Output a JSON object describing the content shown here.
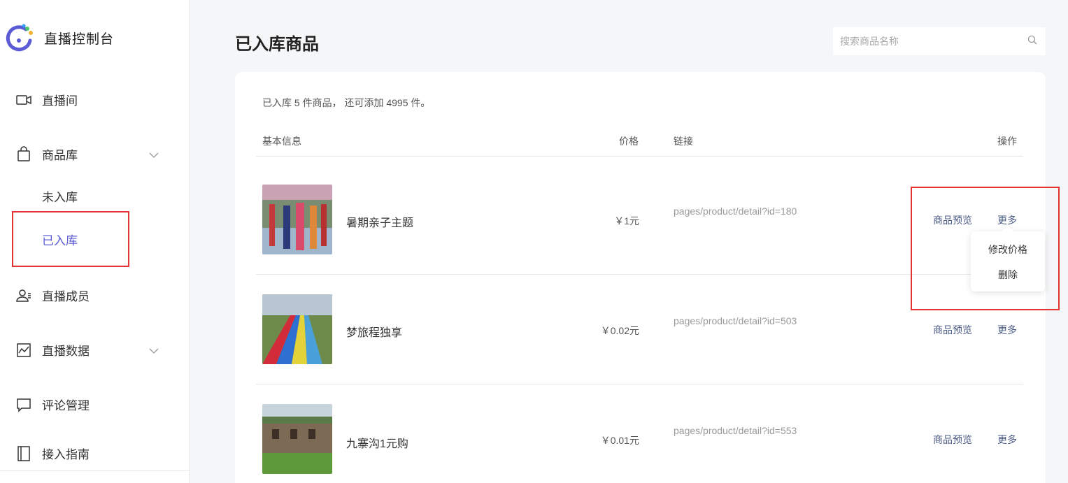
{
  "brand": {
    "name": "直播控制台",
    "icon": "brand-logo-icon"
  },
  "sidebar": {
    "items": [
      {
        "label": "直播间",
        "icon": "video-camera-icon"
      },
      {
        "label": "商品库",
        "icon": "shopping-bag-icon",
        "expanded": true,
        "children": [
          {
            "label": "未入库"
          },
          {
            "label": "已入库",
            "active": true
          }
        ]
      },
      {
        "label": "直播成员",
        "icon": "members-icon"
      },
      {
        "label": "直播数据",
        "icon": "chart-icon"
      },
      {
        "label": "评论管理",
        "icon": "comment-icon"
      },
      {
        "label": "接入指南",
        "icon": "book-icon"
      }
    ]
  },
  "page": {
    "title": "已入库商品"
  },
  "search": {
    "placeholder": "搜索商品名称",
    "value": ""
  },
  "summary": "已入库 5 件商品， 还可添加 4995 件。",
  "table": {
    "headers": {
      "info": "基本信息",
      "price": "价格",
      "link": "链接",
      "ops": "操作"
    },
    "rows": [
      {
        "name": "暑期亲子主题",
        "price": "￥1元",
        "link": "pages/product/detail?id=180",
        "preview": "商品预览",
        "more": "更多"
      },
      {
        "name": "梦旅程独享",
        "price": "￥0.02元",
        "link": "pages/product/detail?id=503",
        "preview": "商品预览",
        "more": "更多"
      },
      {
        "name": "九寨沟1元购",
        "price": "￥0.01元",
        "link": "pages/product/detail?id=553",
        "preview": "商品预览",
        "more": "更多"
      }
    ]
  },
  "dropdown": {
    "items": [
      {
        "label": "修改价格"
      },
      {
        "label": "删除"
      }
    ]
  },
  "colors": {
    "accent": "#5b5bd6",
    "highlight": "#e23232",
    "link": "#4a5a84"
  }
}
